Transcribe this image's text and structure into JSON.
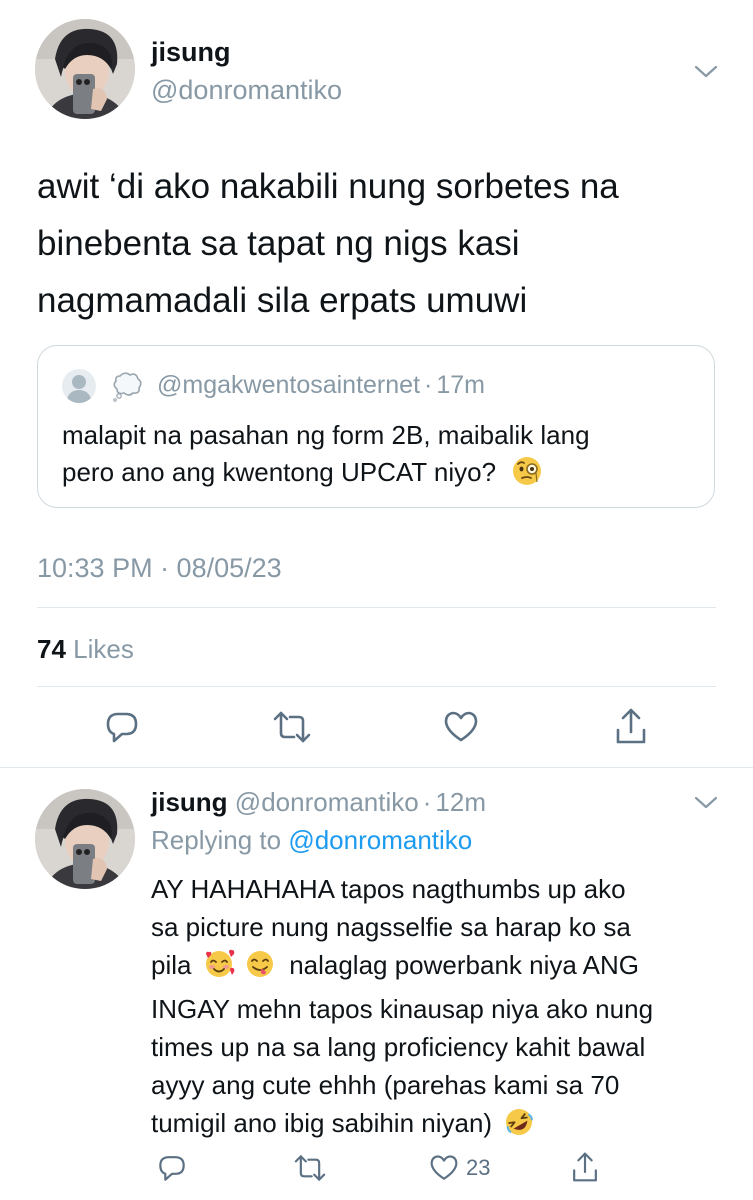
{
  "tweet": {
    "display_name": "jisung",
    "handle": "@donromantiko",
    "text_lines": [
      "awit ‘di ako nakabili nung sorbetes na",
      "binebenta sa tapat ng nigs kasi",
      "nagmamadali sila erpats umuwi"
    ],
    "quote": {
      "handle": "@mgakwentosainternet",
      "separator": "·",
      "time": "17m",
      "line1": "malapit na pasahan ng form 2B, maibalik lang",
      "line2": "pero ano ang kwentong UPCAT niyo?"
    },
    "timestamp": "10:33 PM · 08/05/23",
    "likes_count": "74",
    "likes_label": "Likes",
    "icons": [
      "reply-icon",
      "retweet-icon",
      "like-icon",
      "share-icon",
      "chevron-down-icon"
    ]
  },
  "reply": {
    "display_name": "jisung",
    "handle": "@donromantiko",
    "separator": "·",
    "time": "12m",
    "replying_prefix": "Replying to",
    "replying_handle": "@donromantiko",
    "line1": "AY HAHAHAHA tapos nagthumbs up ako",
    "line2": "sa picture nung nagsselfie sa harap ko sa",
    "line3_before": "pila",
    "line3_after": "nalaglag powerbank niya ANG",
    "line4": "INGAY mehn tapos kinausap niya ako nung",
    "line5": "times up na sa lang proficiency kahit bawal",
    "line6": "ayyy ang cute ehhh (parehas kami sa 70",
    "line7": "tumigil ano ibig sabihin niyan)",
    "like_count": "23"
  },
  "colors": {
    "accent": "#1d9bf0",
    "muted": "#8899a6",
    "text": "#0f1419",
    "divider": "#e1e8ed"
  }
}
